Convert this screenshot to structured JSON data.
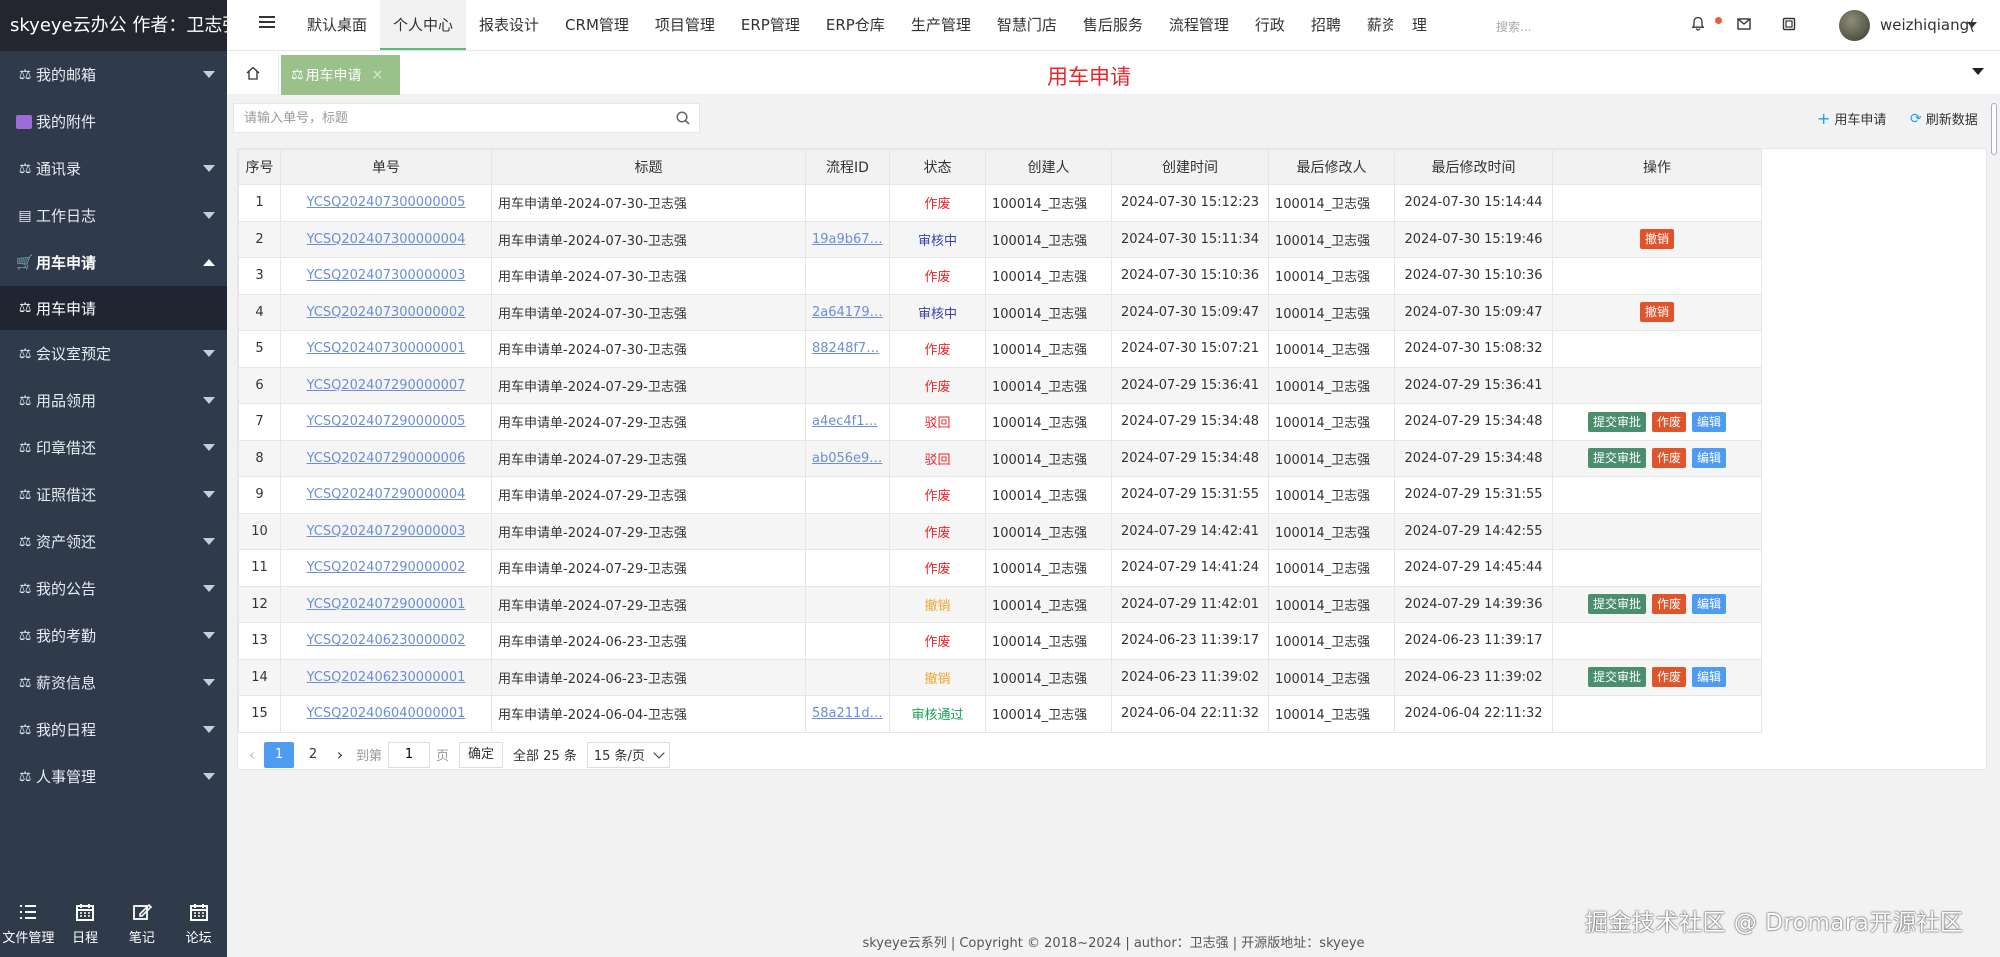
{
  "brand": "skyeye云办公 作者：卫志强",
  "sidebar": {
    "items": [
      {
        "label": "我的邮箱",
        "icon": "scale-icon"
      },
      {
        "label": "我的附件",
        "icon": "attachment-icon"
      },
      {
        "label": "通讯录",
        "icon": "scale-icon"
      },
      {
        "label": "工作日志",
        "icon": "list-icon"
      },
      {
        "label": "用车申请",
        "icon": "cart-icon",
        "open": true
      }
    ],
    "sub_item": "用车申请",
    "items_after": [
      {
        "label": "会议室预定"
      },
      {
        "label": "用品领用"
      },
      {
        "label": "印章借还"
      },
      {
        "label": "证照借还"
      },
      {
        "label": "资产领还"
      },
      {
        "label": "我的公告"
      },
      {
        "label": "我的考勤"
      },
      {
        "label": "薪资信息"
      },
      {
        "label": "我的日程"
      },
      {
        "label": "人事管理"
      }
    ],
    "tools": [
      "文件管理",
      "日程",
      "笔记",
      "论坛"
    ]
  },
  "topnav": {
    "items": [
      "默认桌面",
      "个人中心",
      "报表设计",
      "CRM管理",
      "项目管理",
      "ERP管理",
      "ERP仓库",
      "生产管理",
      "智慧门店",
      "售后服务",
      "流程管理",
      "行政",
      "招聘",
      "薪资管理"
    ],
    "active_index": 1,
    "search_placeholder": "搜索...",
    "username": "weizhiqiang("
  },
  "tabbar": {
    "tab_label": "用车申请",
    "tab_close": "×",
    "page_title": "用车申请"
  },
  "toolbar": {
    "search_placeholder": "请输入单号，标题",
    "add_label": "用车申请",
    "refresh_label": "刷新数据"
  },
  "table": {
    "headers": [
      "序号",
      "单号",
      "标题",
      "流程ID",
      "状态",
      "创建人",
      "创建时间",
      "最后修改人",
      "最后修改时间",
      "操作"
    ],
    "rows": [
      {
        "no": "1",
        "code": "YCSQ202407300000005",
        "title": "用车申请单-2024-07-30-卫志强",
        "pid": "",
        "status": "作废",
        "st": "cancel",
        "creator": "100014_卫志强",
        "ctime": "2024-07-30 15:12:23",
        "modifier": "100014_卫志强",
        "mtime": "2024-07-30 15:14:44",
        "ops": []
      },
      {
        "no": "2",
        "code": "YCSQ202407300000004",
        "title": "用车申请单-2024-07-30-卫志强",
        "pid": "19a9b67…",
        "status": "审核中",
        "st": "review",
        "creator": "100014_卫志强",
        "ctime": "2024-07-30 15:11:34",
        "modifier": "100014_卫志强",
        "mtime": "2024-07-30 15:19:46",
        "ops": [
          "撤销"
        ]
      },
      {
        "no": "3",
        "code": "YCSQ202407300000003",
        "title": "用车申请单-2024-07-30-卫志强",
        "pid": "",
        "status": "作废",
        "st": "cancel",
        "creator": "100014_卫志强",
        "ctime": "2024-07-30 15:10:36",
        "modifier": "100014_卫志强",
        "mtime": "2024-07-30 15:10:36",
        "ops": []
      },
      {
        "no": "4",
        "code": "YCSQ202407300000002",
        "title": "用车申请单-2024-07-30-卫志强",
        "pid": "2a64179…",
        "status": "审核中",
        "st": "review",
        "creator": "100014_卫志强",
        "ctime": "2024-07-30 15:09:47",
        "modifier": "100014_卫志强",
        "mtime": "2024-07-30 15:09:47",
        "ops": [
          "撤销"
        ]
      },
      {
        "no": "5",
        "code": "YCSQ202407300000001",
        "title": "用车申请单-2024-07-30-卫志强",
        "pid": "88248f7…",
        "status": "作废",
        "st": "cancel",
        "creator": "100014_卫志强",
        "ctime": "2024-07-30 15:07:21",
        "modifier": "100014_卫志强",
        "mtime": "2024-07-30 15:08:32",
        "ops": []
      },
      {
        "no": "6",
        "code": "YCSQ202407290000007",
        "title": "用车申请单-2024-07-29-卫志强",
        "pid": "",
        "status": "作废",
        "st": "cancel",
        "creator": "100014_卫志强",
        "ctime": "2024-07-29 15:36:41",
        "modifier": "100014_卫志强",
        "mtime": "2024-07-29 15:36:41",
        "ops": []
      },
      {
        "no": "7",
        "code": "YCSQ202407290000005",
        "title": "用车申请单-2024-07-29-卫志强",
        "pid": "a4ec4f1…",
        "status": "驳回",
        "st": "reject",
        "creator": "100014_卫志强",
        "ctime": "2024-07-29 15:34:48",
        "modifier": "100014_卫志强",
        "mtime": "2024-07-29 15:34:48",
        "ops": [
          "提交审批",
          "作废",
          "编辑"
        ]
      },
      {
        "no": "8",
        "code": "YCSQ202407290000006",
        "title": "用车申请单-2024-07-29-卫志强",
        "pid": "ab056e9…",
        "status": "驳回",
        "st": "reject",
        "creator": "100014_卫志强",
        "ctime": "2024-07-29 15:34:48",
        "modifier": "100014_卫志强",
        "mtime": "2024-07-29 15:34:48",
        "ops": [
          "提交审批",
          "作废",
          "编辑"
        ]
      },
      {
        "no": "9",
        "code": "YCSQ202407290000004",
        "title": "用车申请单-2024-07-29-卫志强",
        "pid": "",
        "status": "作废",
        "st": "cancel",
        "creator": "100014_卫志强",
        "ctime": "2024-07-29 15:31:55",
        "modifier": "100014_卫志强",
        "mtime": "2024-07-29 15:31:55",
        "ops": []
      },
      {
        "no": "10",
        "code": "YCSQ202407290000003",
        "title": "用车申请单-2024-07-29-卫志强",
        "pid": "",
        "status": "作废",
        "st": "cancel",
        "creator": "100014_卫志强",
        "ctime": "2024-07-29 14:42:41",
        "modifier": "100014_卫志强",
        "mtime": "2024-07-29 14:42:55",
        "ops": []
      },
      {
        "no": "11",
        "code": "YCSQ202407290000002",
        "title": "用车申请单-2024-07-29-卫志强",
        "pid": "",
        "status": "作废",
        "st": "cancel",
        "creator": "100014_卫志强",
        "ctime": "2024-07-29 14:41:24",
        "modifier": "100014_卫志强",
        "mtime": "2024-07-29 14:45:44",
        "ops": []
      },
      {
        "no": "12",
        "code": "YCSQ202407290000001",
        "title": "用车申请单-2024-07-29-卫志强",
        "pid": "",
        "status": "撤销",
        "st": "revoke",
        "creator": "100014_卫志强",
        "ctime": "2024-07-29 11:42:01",
        "modifier": "100014_卫志强",
        "mtime": "2024-07-29 14:39:36",
        "ops": [
          "提交审批",
          "作废",
          "编辑"
        ]
      },
      {
        "no": "13",
        "code": "YCSQ202406230000002",
        "title": "用车申请单-2024-06-23-卫志强",
        "pid": "",
        "status": "作废",
        "st": "cancel",
        "creator": "100014_卫志强",
        "ctime": "2024-06-23 11:39:17",
        "modifier": "100014_卫志强",
        "mtime": "2024-06-23 11:39:17",
        "ops": []
      },
      {
        "no": "14",
        "code": "YCSQ202406230000001",
        "title": "用车申请单-2024-06-23-卫志强",
        "pid": "",
        "status": "撤销",
        "st": "revoke",
        "creator": "100014_卫志强",
        "ctime": "2024-06-23 11:39:02",
        "modifier": "100014_卫志强",
        "mtime": "2024-06-23 11:39:02",
        "ops": [
          "提交审批",
          "作废",
          "编辑"
        ]
      },
      {
        "no": "15",
        "code": "YCSQ202406040000001",
        "title": "用车申请单-2024-06-04-卫志强",
        "pid": "58a211d…",
        "status": "审核通过",
        "st": "pass",
        "creator": "100014_卫志强",
        "ctime": "2024-06-04 22:11:32",
        "modifier": "100014_卫志强",
        "mtime": "2024-06-04 22:11:32",
        "ops": []
      }
    ]
  },
  "pager": {
    "pages": [
      "1",
      "2"
    ],
    "current": "1",
    "goto_label": "到第",
    "goto_value": "1",
    "page_unit": "页",
    "confirm": "确定",
    "total": "全部 25 条",
    "page_size": "15 条/页"
  },
  "footer": "skyeye云系列 | Copyright © 2018~2024 | author：卫志强 | 开源版地址：skyeye",
  "watermark": "掘金技术社区 @ Dromara开源社区",
  "colors": {
    "sidebar_bg": "#2f3a4b",
    "brand_bg": "#23262e",
    "tab_active_bg": "#9bc18b",
    "title_red": "#e8262b",
    "accent_blue": "#1e9fff",
    "btn_submit": "#4a8e6e",
    "btn_cancel": "#e0542b",
    "btn_edit": "#4e9cf1"
  }
}
